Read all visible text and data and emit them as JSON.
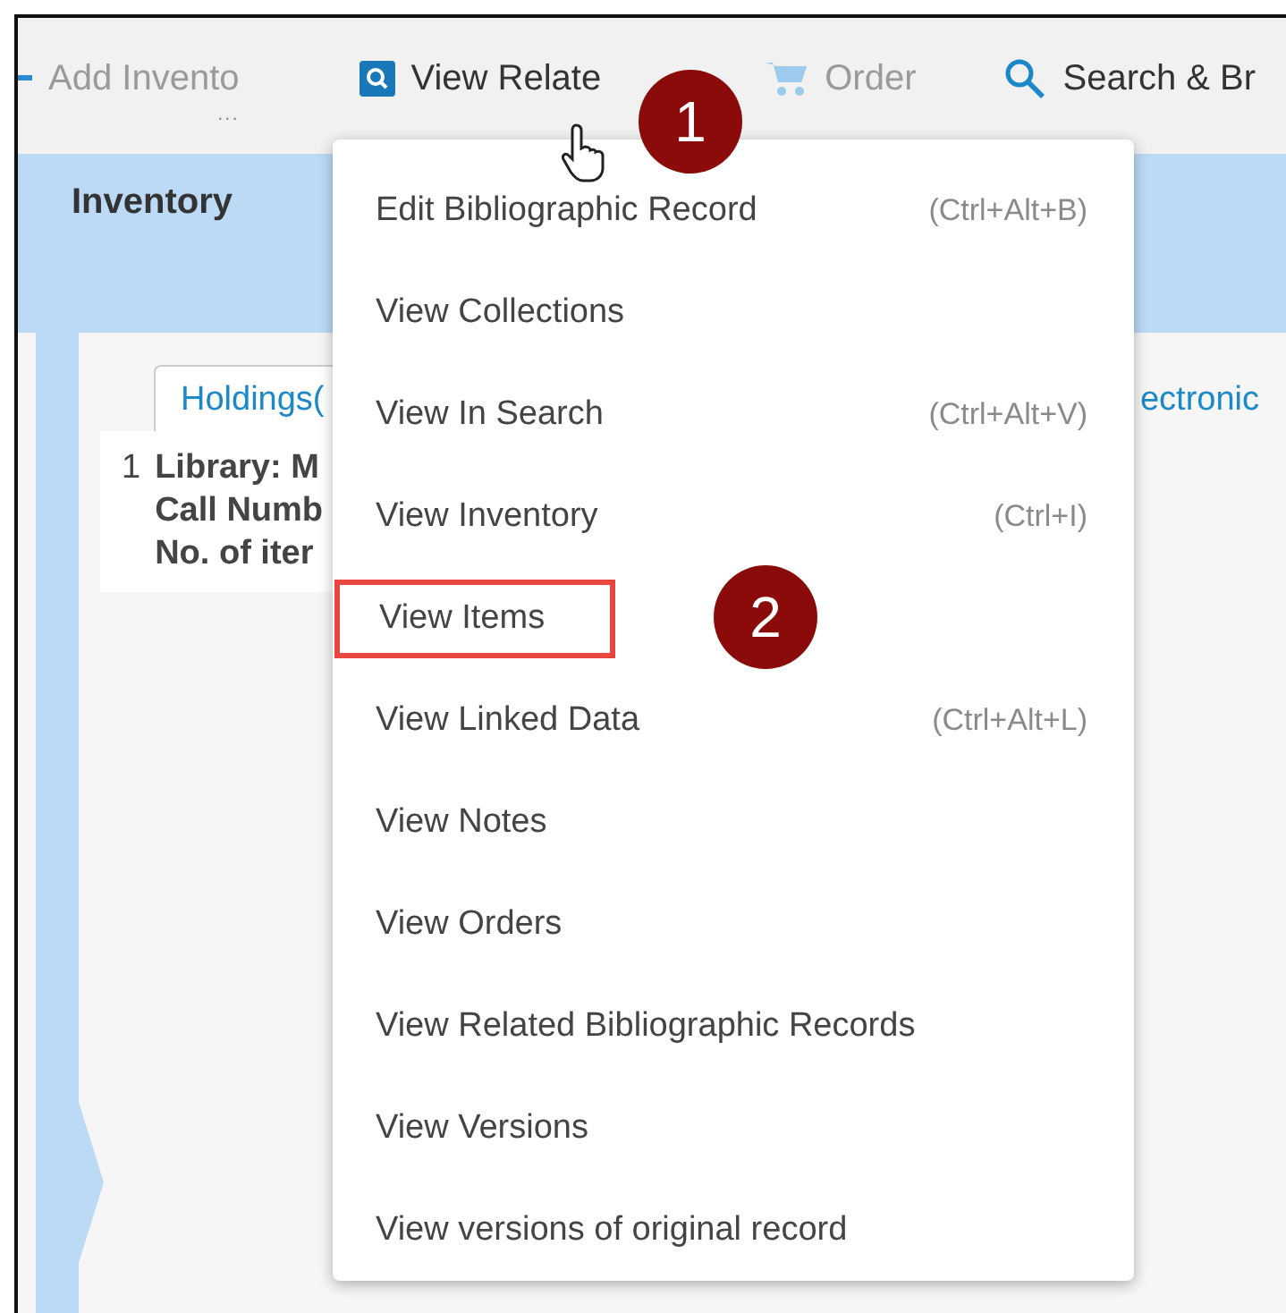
{
  "toolbar": {
    "items": [
      {
        "kind": "add",
        "label": "Add Invento",
        "more": "...",
        "disabled": true
      },
      {
        "kind": "related",
        "label": "View Relate",
        "disabled": false
      },
      {
        "kind": "order",
        "label": "Order",
        "disabled": true
      },
      {
        "kind": "search",
        "label": "Search & Br",
        "disabled": false
      }
    ]
  },
  "header": {
    "title": "Inventory"
  },
  "tabs": [
    {
      "label": "Holdings(",
      "selected": true
    },
    {
      "label": "ectronic",
      "selected": false
    }
  ],
  "record": {
    "number": "1",
    "lines": [
      "Library: M",
      "Call Numb",
      "No. of iter"
    ]
  },
  "menu": {
    "items": [
      {
        "label": "Edit Bibliographic Record",
        "shortcut": "(Ctrl+Alt+B)",
        "highlighted": false
      },
      {
        "label": "View Collections",
        "highlighted": false
      },
      {
        "label": "View In Search",
        "shortcut": "(Ctrl+Alt+V)",
        "highlighted": false
      },
      {
        "label": "View Inventory",
        "shortcut": "(Ctrl+I)",
        "highlighted": false
      },
      {
        "label": "View Items",
        "highlighted": true
      },
      {
        "label": "View Linked Data",
        "shortcut": "(Ctrl+Alt+L)",
        "highlighted": false
      },
      {
        "label": "View Notes",
        "highlighted": false
      },
      {
        "label": "View Orders",
        "highlighted": false
      },
      {
        "label": "View Related Bibliographic Records",
        "highlighted": false
      },
      {
        "label": "View Versions",
        "highlighted": false
      },
      {
        "label": "View versions of original record",
        "highlighted": false
      }
    ]
  },
  "callouts": [
    "1",
    "2"
  ]
}
